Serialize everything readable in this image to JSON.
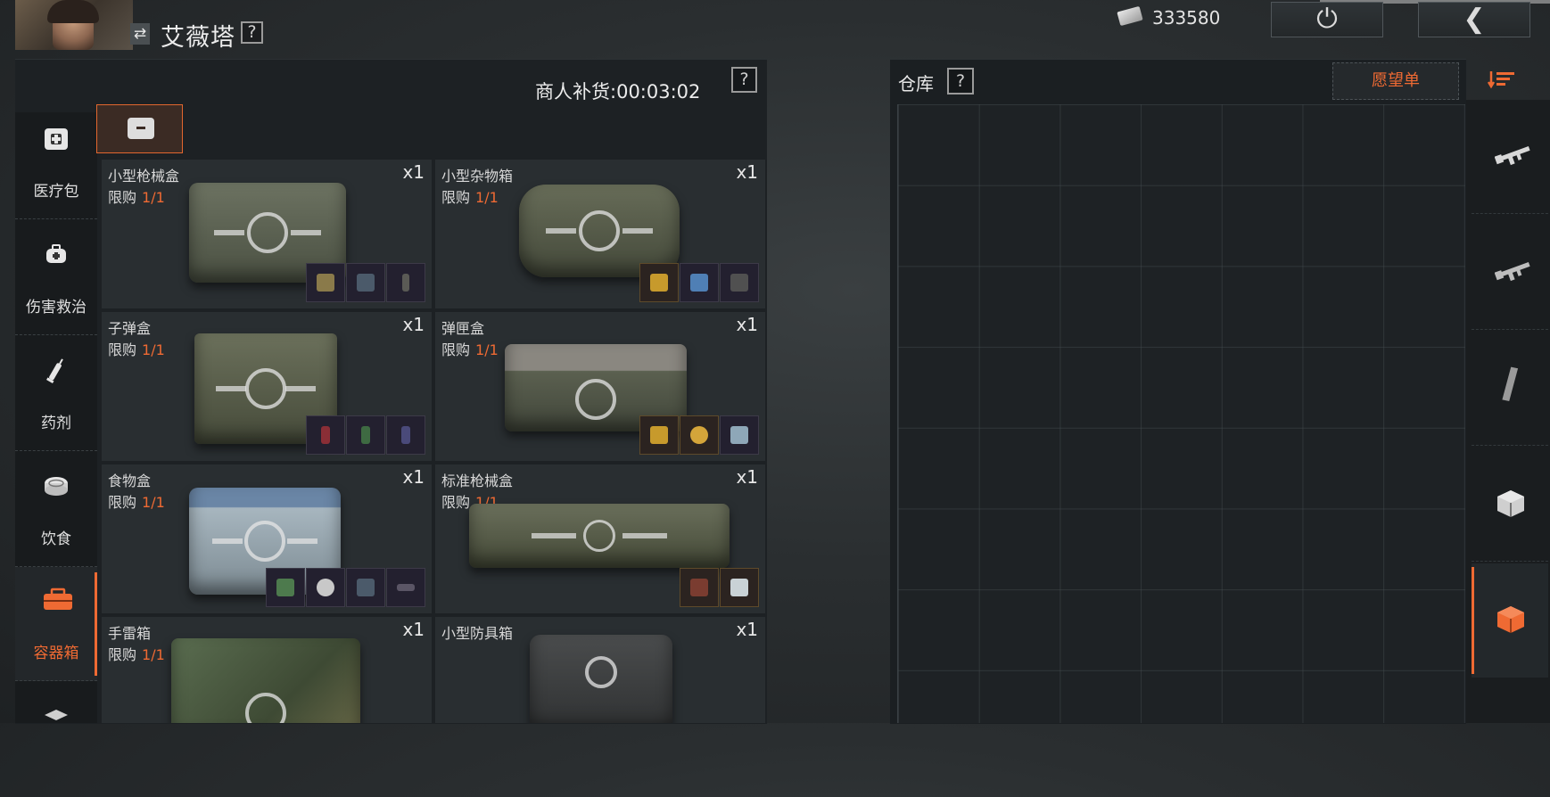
{
  "header": {
    "character_name": "艾薇塔",
    "help_label": "?",
    "currency_amount": "333580",
    "power_icon": "power-icon",
    "back_icon": "chevron-left-icon"
  },
  "shop": {
    "restock_label": "商人补货:",
    "restock_time": "00:03:02",
    "help_label": "?",
    "categories": [
      {
        "label": "医疗包",
        "icon": "medkit-icon",
        "active": false
      },
      {
        "label": "伤害救治",
        "icon": "first-aid-bag-icon",
        "active": false
      },
      {
        "label": "药剂",
        "icon": "syringe-icon",
        "active": false
      },
      {
        "label": "饮食",
        "icon": "food-can-icon",
        "active": false
      },
      {
        "label": "容器箱",
        "icon": "container-box-icon",
        "active": true
      }
    ],
    "limit_label": "限购",
    "items": [
      {
        "name": "小型枪械盒",
        "limit": "1/1",
        "qty": "x1"
      },
      {
        "name": "小型杂物箱",
        "limit": "1/1",
        "qty": "x1"
      },
      {
        "name": "子弹盒",
        "limit": "1/1",
        "qty": "x1"
      },
      {
        "name": "弹匣盒",
        "limit": "1/1",
        "qty": "x1"
      },
      {
        "name": "食物盒",
        "limit": "1/1",
        "qty": "x1"
      },
      {
        "name": "标准枪械盒",
        "limit": "1/1",
        "qty": "x1"
      },
      {
        "name": "手雷箱",
        "limit": "1/1",
        "qty": "x1"
      },
      {
        "name": "小型防具箱",
        "limit": "",
        "qty": "x1"
      }
    ]
  },
  "warehouse": {
    "title": "仓库",
    "help_label": "?",
    "wishlist_label": "愿望单",
    "sort_icon": "sort-icon",
    "categories": [
      {
        "icon": "rifle-icon",
        "active": false
      },
      {
        "icon": "rifle-alt-icon",
        "active": false
      },
      {
        "icon": "magazine-icon",
        "active": false
      },
      {
        "icon": "cube-icon",
        "active": false
      },
      {
        "icon": "container-cube-icon",
        "active": true
      }
    ]
  },
  "colors": {
    "accent": "#ef6a33",
    "panel": "#1d2124",
    "card": "#292e31"
  }
}
